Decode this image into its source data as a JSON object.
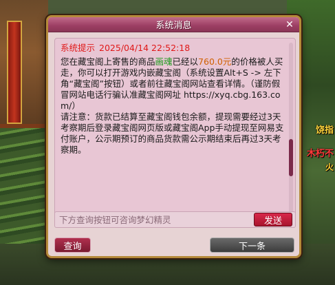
{
  "dialog": {
    "title": "系统消息",
    "close_glyph": "✕"
  },
  "message": {
    "tag": "系统提示",
    "timestamp": "2025/04/14 22:52:18",
    "p1_a": "您在藏宝阁上寄售的商品",
    "item_name": "画魂",
    "p1_b": "已经以",
    "price": "760.0元",
    "p1_c": "的价格被人买走，你可以打开游戏内嵌藏宝阁（系统设置Alt+S -> 左下角“藏宝阁”按钮）或者前往藏宝阁网站查看详情。（谨防假冒网站电话行骗认准藏宝阁网址 https://xyq.cbg.163.com/）",
    "p2": "请注意：货款已结算至藏宝阁钱包余额，提现需要经过3天考察期后登录藏宝阁网页版或藏宝阁App手动提现至网易支付账户，公示期预订的商品货款需公示期结束后再过3天考察期。"
  },
  "input": {
    "placeholder": "下方查询按钮可咨询梦幻精灵",
    "value": ""
  },
  "buttons": {
    "send": "发送",
    "query": "查询",
    "next": "下一条"
  },
  "backdrop_signs": {
    "s1": "饶指",
    "s2": "木朽不",
    "s3": "火"
  },
  "colors": {
    "system_tag": "#e01818",
    "item_name": "#1a9a1a",
    "price": "#d06000",
    "titlebar": "#9c3e63",
    "send_button": "#c01c3a"
  }
}
